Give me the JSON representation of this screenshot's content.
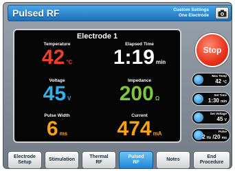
{
  "header": {
    "title": "Pulsed RF",
    "custom_line1": "Custom Settings",
    "custom_line2": "One Electrode"
  },
  "panel": {
    "electrode": "Electrode 1",
    "temperature": {
      "label": "Temperature",
      "value": "42",
      "unit": "°C"
    },
    "elapsed": {
      "label": "Elapsed Time",
      "value": "1:19",
      "unit": "min"
    },
    "voltage": {
      "label": "Voltage",
      "value": "45",
      "unit": "V"
    },
    "impedance": {
      "label": "Impedance",
      "value": "200",
      "unit": "Ω"
    },
    "pulse_width": {
      "label": "Pulse Width",
      "value": "6",
      "unit": "ms"
    },
    "current": {
      "label": "Current",
      "value": "474",
      "unit": "mA"
    }
  },
  "stop_label": "Stop",
  "settings": [
    {
      "label": "Max Temp",
      "value": "42",
      "unit": "°C"
    },
    {
      "label": "Set Time",
      "value": "1:30",
      "unit": "min"
    },
    {
      "label": "Set Voltage",
      "value": "45",
      "unit": "V"
    },
    {
      "label": "Pulse",
      "value": "2",
      "unit": "Hz",
      "value2": "20",
      "unit2": "ms"
    }
  ],
  "nav": [
    {
      "label": "Electrode\nSetup"
    },
    {
      "label": "Stimulation"
    },
    {
      "label": "Thermal\nRF"
    },
    {
      "label": "Pulsed\nRF"
    },
    {
      "label": "Notes"
    },
    {
      "label": "End\nProcedure"
    }
  ],
  "colors": {
    "temperature": "#ee3d2b",
    "voltage": "#2fb1ec",
    "impedance": "#7ec540",
    "pulse_width": "#f7a215",
    "current": "#f7a215",
    "active_tab": "#1e86d4"
  },
  "icons": {
    "screenshot": "camera-icon"
  }
}
